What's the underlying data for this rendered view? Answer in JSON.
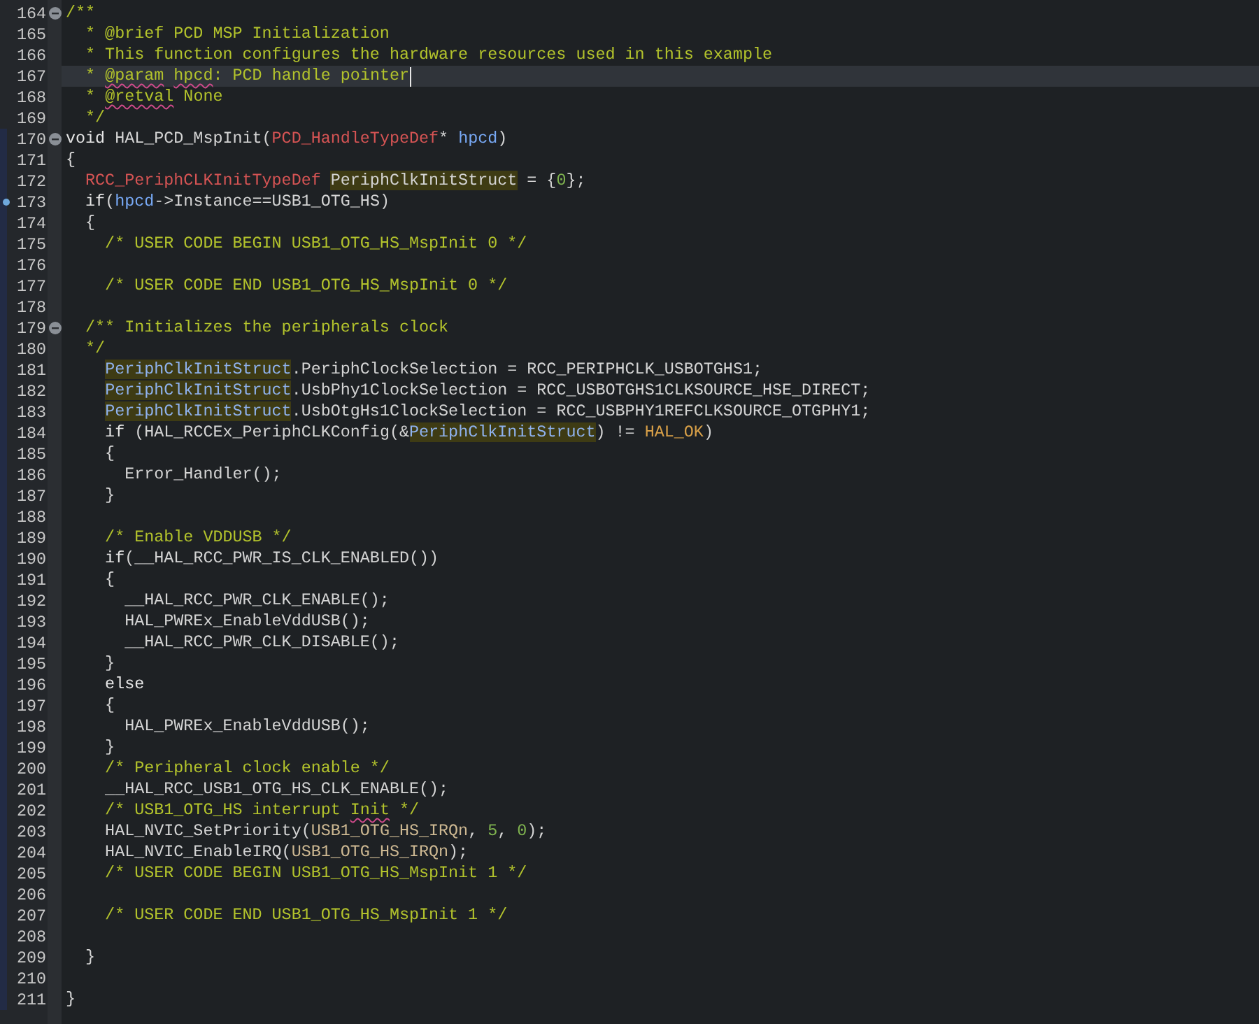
{
  "editor": {
    "lines": [
      {
        "number": "164",
        "fold": true,
        "modified": false,
        "current": false,
        "marker": false,
        "tokens": [
          {
            "kind": "comment",
            "text": "/**"
          }
        ]
      },
      {
        "number": "165",
        "fold": false,
        "modified": false,
        "current": false,
        "marker": false,
        "tokens": [
          {
            "kind": "comment",
            "text": "  * @brief PCD MSP Initialization"
          }
        ]
      },
      {
        "number": "166",
        "fold": false,
        "modified": false,
        "current": false,
        "marker": false,
        "tokens": [
          {
            "kind": "comment",
            "text": "  * This function configures the hardware resources used in this example"
          }
        ]
      },
      {
        "number": "167",
        "fold": false,
        "modified": false,
        "current": true,
        "marker": false,
        "tokens": [
          {
            "kind": "comment",
            "text": "  * "
          },
          {
            "kind": "comment",
            "text": "@param",
            "spell": true
          },
          {
            "kind": "comment",
            "text": " hpcd",
            "spell": true
          },
          {
            "kind": "comment",
            "text": ": PCD handle pointer"
          }
        ]
      },
      {
        "number": "168",
        "fold": false,
        "modified": false,
        "current": false,
        "marker": false,
        "tokens": [
          {
            "kind": "comment",
            "text": "  * "
          },
          {
            "kind": "comment",
            "text": "@retval",
            "spell": true
          },
          {
            "kind": "comment",
            "text": " None"
          }
        ]
      },
      {
        "number": "169",
        "fold": false,
        "modified": false,
        "current": false,
        "marker": false,
        "tokens": [
          {
            "kind": "comment",
            "text": "  */"
          }
        ]
      },
      {
        "number": "170",
        "fold": true,
        "modified": true,
        "current": false,
        "marker": false,
        "tokens": [
          {
            "kind": "keyword",
            "text": "void"
          },
          {
            "kind": "plain",
            "text": " HAL_PCD_MspInit("
          },
          {
            "kind": "type",
            "text": "PCD_HandleTypeDef"
          },
          {
            "kind": "plain",
            "text": "* "
          },
          {
            "kind": "param",
            "text": "hpcd"
          },
          {
            "kind": "plain",
            "text": ")"
          }
        ]
      },
      {
        "number": "171",
        "fold": false,
        "modified": true,
        "current": false,
        "marker": false,
        "tokens": [
          {
            "kind": "plain",
            "text": "{"
          }
        ]
      },
      {
        "number": "172",
        "fold": false,
        "modified": true,
        "current": false,
        "marker": false,
        "tokens": [
          {
            "kind": "type",
            "text": "  RCC_PeriphCLKInitTypeDef"
          },
          {
            "kind": "plain",
            "text": " PeriphClkInitStruct",
            "mark": true
          },
          {
            "kind": "plain",
            "text": " = {"
          },
          {
            "kind": "number",
            "text": "0"
          },
          {
            "kind": "plain",
            "text": "};"
          }
        ]
      },
      {
        "number": "173",
        "fold": false,
        "modified": true,
        "current": false,
        "marker": true,
        "tokens": [
          {
            "kind": "keyword",
            "text": "  if"
          },
          {
            "kind": "plain",
            "text": "("
          },
          {
            "kind": "param",
            "text": "hpcd"
          },
          {
            "kind": "plain",
            "text": "->Instance==USB1_OTG_HS)"
          }
        ]
      },
      {
        "number": "174",
        "fold": false,
        "modified": true,
        "current": false,
        "marker": false,
        "tokens": [
          {
            "kind": "plain",
            "text": "  {"
          }
        ]
      },
      {
        "number": "175",
        "fold": false,
        "modified": true,
        "current": false,
        "marker": false,
        "tokens": [
          {
            "kind": "comment",
            "text": "    /* USER CODE BEGIN USB1_OTG_HS_MspInit 0 */"
          }
        ]
      },
      {
        "number": "176",
        "fold": false,
        "modified": true,
        "current": false,
        "marker": false
      },
      {
        "number": "177",
        "fold": false,
        "modified": true,
        "current": false,
        "marker": false,
        "tokens": [
          {
            "kind": "comment",
            "text": "    /* USER CODE END USB1_OTG_HS_MspInit 0 */"
          }
        ]
      },
      {
        "number": "178",
        "fold": false,
        "modified": true,
        "current": false,
        "marker": false
      },
      {
        "number": "179",
        "fold": true,
        "modified": true,
        "current": false,
        "marker": false,
        "tokens": [
          {
            "kind": "comment",
            "text": "  /** Initializes the peripherals clock"
          }
        ]
      },
      {
        "number": "180",
        "fold": false,
        "modified": true,
        "current": false,
        "marker": false,
        "tokens": [
          {
            "kind": "comment",
            "text": "  */"
          }
        ]
      },
      {
        "number": "181",
        "fold": false,
        "modified": true,
        "current": false,
        "marker": false,
        "tokens": [
          {
            "kind": "variable",
            "text": "    PeriphClkInitStruct",
            "mark": true
          },
          {
            "kind": "plain",
            "text": ".PeriphClockSelection = RCC_PERIPHCLK_USBOTGHS1;"
          }
        ]
      },
      {
        "number": "182",
        "fold": false,
        "modified": true,
        "current": false,
        "marker": false,
        "tokens": [
          {
            "kind": "variable",
            "text": "    PeriphClkInitStruct",
            "mark": true
          },
          {
            "kind": "plain",
            "text": ".UsbPhy1ClockSelection = RCC_USBOTGHS1CLKSOURCE_HSE_DIRECT;"
          }
        ]
      },
      {
        "number": "183",
        "fold": false,
        "modified": true,
        "current": false,
        "marker": false,
        "tokens": [
          {
            "kind": "variable",
            "text": "    PeriphClkInitStruct",
            "mark": true
          },
          {
            "kind": "plain",
            "text": ".UsbOtgHs1ClockSelection = RCC_USBPHY1REFCLKSOURCE_OTGPHY1;"
          }
        ]
      },
      {
        "number": "184",
        "fold": false,
        "modified": true,
        "current": false,
        "marker": false,
        "tokens": [
          {
            "kind": "keyword",
            "text": "    if"
          },
          {
            "kind": "plain",
            "text": " (HAL_RCCEx_PeriphCLKConfig(&"
          },
          {
            "kind": "variable",
            "text": "PeriphClkInitStruct",
            "mark": true
          },
          {
            "kind": "plain",
            "text": ") != "
          },
          {
            "kind": "macro",
            "text": "HAL_OK"
          },
          {
            "kind": "plain",
            "text": ")"
          }
        ]
      },
      {
        "number": "185",
        "fold": false,
        "modified": true,
        "current": false,
        "marker": false,
        "tokens": [
          {
            "kind": "plain",
            "text": "    {"
          }
        ]
      },
      {
        "number": "186",
        "fold": false,
        "modified": true,
        "current": false,
        "marker": false,
        "tokens": [
          {
            "kind": "plain",
            "text": "      Error_Handler();"
          }
        ]
      },
      {
        "number": "187",
        "fold": false,
        "modified": true,
        "current": false,
        "marker": false,
        "tokens": [
          {
            "kind": "plain",
            "text": "    }"
          }
        ]
      },
      {
        "number": "188",
        "fold": false,
        "modified": true,
        "current": false,
        "marker": false
      },
      {
        "number": "189",
        "fold": false,
        "modified": true,
        "current": false,
        "marker": false,
        "tokens": [
          {
            "kind": "comment",
            "text": "    /* Enable VDDUSB */"
          }
        ]
      },
      {
        "number": "190",
        "fold": false,
        "modified": true,
        "current": false,
        "marker": false,
        "tokens": [
          {
            "kind": "keyword",
            "text": "    if"
          },
          {
            "kind": "plain",
            "text": "(__HAL_RCC_PWR_IS_CLK_ENABLED())"
          }
        ]
      },
      {
        "number": "191",
        "fold": false,
        "modified": true,
        "current": false,
        "marker": false,
        "tokens": [
          {
            "kind": "plain",
            "text": "    {"
          }
        ]
      },
      {
        "number": "192",
        "fold": false,
        "modified": true,
        "current": false,
        "marker": false,
        "tokens": [
          {
            "kind": "plain",
            "text": "      __HAL_RCC_PWR_CLK_ENABLE();"
          }
        ]
      },
      {
        "number": "193",
        "fold": false,
        "modified": true,
        "current": false,
        "marker": false,
        "tokens": [
          {
            "kind": "plain",
            "text": "      HAL_PWREx_EnableVddUSB();"
          }
        ]
      },
      {
        "number": "194",
        "fold": false,
        "modified": true,
        "current": false,
        "marker": false,
        "tokens": [
          {
            "kind": "plain",
            "text": "      __HAL_RCC_PWR_CLK_DISABLE();"
          }
        ]
      },
      {
        "number": "195",
        "fold": false,
        "modified": true,
        "current": false,
        "marker": false,
        "tokens": [
          {
            "kind": "plain",
            "text": "    }"
          }
        ]
      },
      {
        "number": "196",
        "fold": false,
        "modified": true,
        "current": false,
        "marker": false,
        "tokens": [
          {
            "kind": "keyword",
            "text": "    else"
          }
        ]
      },
      {
        "number": "197",
        "fold": false,
        "modified": true,
        "current": false,
        "marker": false,
        "tokens": [
          {
            "kind": "plain",
            "text": "    {"
          }
        ]
      },
      {
        "number": "198",
        "fold": false,
        "modified": true,
        "current": false,
        "marker": false,
        "tokens": [
          {
            "kind": "plain",
            "text": "      HAL_PWREx_EnableVddUSB();"
          }
        ]
      },
      {
        "number": "199",
        "fold": false,
        "modified": true,
        "current": false,
        "marker": false,
        "tokens": [
          {
            "kind": "plain",
            "text": "    }"
          }
        ]
      },
      {
        "number": "200",
        "fold": false,
        "modified": true,
        "current": false,
        "marker": false,
        "tokens": [
          {
            "kind": "comment",
            "text": "    /* Peripheral clock enable */"
          }
        ]
      },
      {
        "number": "201",
        "fold": false,
        "modified": true,
        "current": false,
        "marker": false,
        "tokens": [
          {
            "kind": "plain",
            "text": "    __HAL_RCC_USB1_OTG_HS_CLK_ENABLE();"
          }
        ]
      },
      {
        "number": "202",
        "fold": false,
        "modified": true,
        "current": false,
        "marker": false,
        "tokens": [
          {
            "kind": "comment",
            "text": "    /* USB1_OTG_HS interrupt "
          },
          {
            "kind": "comment",
            "text": "Init",
            "spell": true
          },
          {
            "kind": "comment",
            "text": " */"
          }
        ]
      },
      {
        "number": "203",
        "fold": false,
        "modified": true,
        "current": false,
        "marker": false,
        "tokens": [
          {
            "kind": "plain",
            "text": "    HAL_NVIC_SetPriority("
          },
          {
            "kind": "enum",
            "text": "USB1_OTG_HS_IRQn"
          },
          {
            "kind": "plain",
            "text": ", "
          },
          {
            "kind": "number",
            "text": "5"
          },
          {
            "kind": "plain",
            "text": ", "
          },
          {
            "kind": "number",
            "text": "0"
          },
          {
            "kind": "plain",
            "text": ");"
          }
        ]
      },
      {
        "number": "204",
        "fold": false,
        "modified": true,
        "current": false,
        "marker": false,
        "tokens": [
          {
            "kind": "plain",
            "text": "    HAL_NVIC_EnableIRQ("
          },
          {
            "kind": "enum",
            "text": "USB1_OTG_HS_IRQn"
          },
          {
            "kind": "plain",
            "text": ");"
          }
        ]
      },
      {
        "number": "205",
        "fold": false,
        "modified": true,
        "current": false,
        "marker": false,
        "tokens": [
          {
            "kind": "comment",
            "text": "    /* USER CODE BEGIN USB1_OTG_HS_MspInit 1 */"
          }
        ]
      },
      {
        "number": "206",
        "fold": false,
        "modified": true,
        "current": false,
        "marker": false
      },
      {
        "number": "207",
        "fold": false,
        "modified": true,
        "current": false,
        "marker": false,
        "tokens": [
          {
            "kind": "comment",
            "text": "    /* USER CODE END USB1_OTG_HS_MspInit 1 */"
          }
        ]
      },
      {
        "number": "208",
        "fold": false,
        "modified": true,
        "current": false,
        "marker": false
      },
      {
        "number": "209",
        "fold": false,
        "modified": true,
        "current": false,
        "marker": false,
        "tokens": [
          {
            "kind": "plain",
            "text": "  }"
          }
        ]
      },
      {
        "number": "210",
        "fold": false,
        "modified": true,
        "current": false,
        "marker": false
      },
      {
        "number": "211",
        "fold": false,
        "modified": true,
        "current": false,
        "marker": false,
        "tokens": [
          {
            "kind": "plain",
            "text": "}"
          }
        ]
      }
    ]
  }
}
